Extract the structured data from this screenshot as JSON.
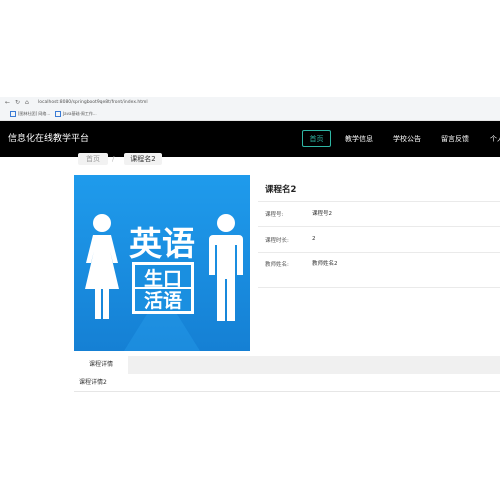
{
  "browser": {
    "address": "localhost:8080/springboot9qe8t/front/index.html",
    "bookmarks": [
      "[图林社团] 网络...",
      "Java基础-周工作..."
    ]
  },
  "header": {
    "site_title": "信息化在线教学平台",
    "nav": [
      {
        "label": "首页",
        "active": true
      },
      {
        "label": "教学信息"
      },
      {
        "label": "学校公告"
      },
      {
        "label": "留言反馈"
      },
      {
        "label": "个人"
      }
    ]
  },
  "breadcrumb": {
    "home": "首页",
    "separator": "/",
    "current": "课程名2"
  },
  "course": {
    "title": "课程名2",
    "image": {
      "title_text": "英语",
      "lines": [
        "生口",
        "活语"
      ],
      "bg_color": "#1a8fe0"
    },
    "fields": [
      {
        "label": "课程号:",
        "value": "课程号2"
      },
      {
        "label": "课程时长:",
        "value": "2"
      },
      {
        "label": "教师姓名:",
        "value": "教师姓名2"
      }
    ]
  },
  "tabs": {
    "items": [
      {
        "label": "课程详情"
      }
    ],
    "content": "课程详情2"
  },
  "colors": {
    "header_bg": "#000000",
    "accent": "#2fb6a4"
  }
}
